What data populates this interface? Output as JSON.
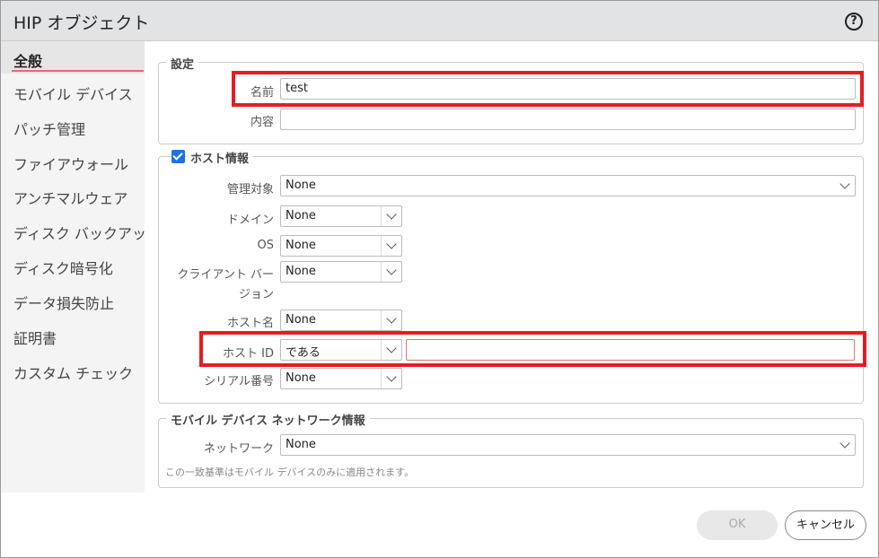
{
  "dialog": {
    "title": "HIP オブジェクト",
    "help_icon": "?"
  },
  "sidebar": {
    "items": [
      {
        "label": "全般"
      },
      {
        "label": "モバイル デバイス"
      },
      {
        "label": "パッチ管理"
      },
      {
        "label": "ファイアウォール"
      },
      {
        "label": "アンチマルウェア"
      },
      {
        "label": "ディスク バックアップ"
      },
      {
        "label": "ディスク暗号化"
      },
      {
        "label": "データ損失防止"
      },
      {
        "label": "証明書"
      },
      {
        "label": "カスタム チェック"
      }
    ]
  },
  "settings": {
    "legend": "設定",
    "name_label": "名前",
    "name_value": "test",
    "desc_label": "内容",
    "desc_value": ""
  },
  "host": {
    "legend": "ホスト情報",
    "checked": true,
    "managed_label": "管理対象",
    "managed_value": "None",
    "domain_label": "ドメイン",
    "domain_value": "None",
    "os_label": "OS",
    "os_value": "None",
    "client_label": "クライアント バー",
    "client_label2": "ジョン",
    "client_value": "None",
    "hostname_label": "ホスト名",
    "hostname_value": "None",
    "hostid_label": "ホスト ID",
    "hostid_op": "である",
    "hostid_value": "",
    "serial_label": "シリアル番号",
    "serial_value": "None"
  },
  "mobile": {
    "legend": "モバイル デバイス ネットワーク情報",
    "network_label": "ネットワーク",
    "network_value": "None",
    "note": "この一致基準はモバイル デバイスのみに適用されます。"
  },
  "buttons": {
    "ok": "OK",
    "cancel": "キャンセル"
  },
  "colors": {
    "highlight": "#e51c23",
    "accent": "#1a73e8"
  }
}
